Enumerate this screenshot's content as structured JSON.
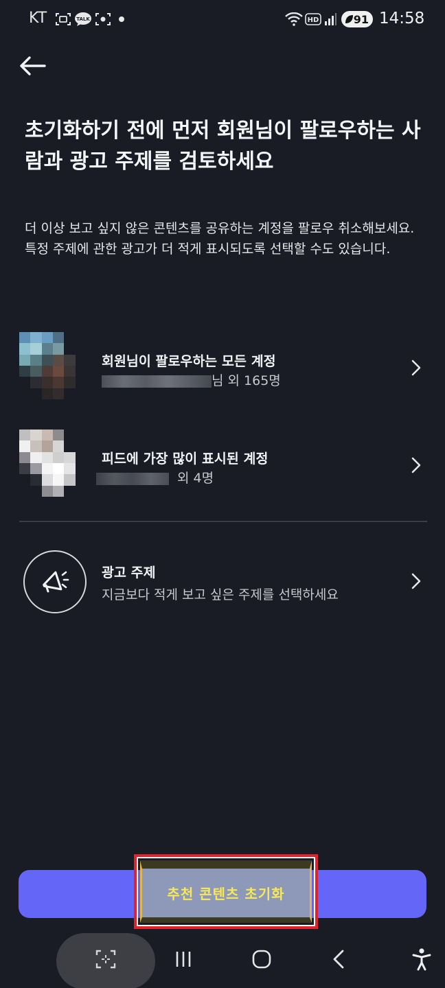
{
  "status_bar": {
    "carrier": "KT",
    "time": "14:58",
    "battery": "91",
    "icons": [
      "screenshot-icon",
      "kakaotalk-icon",
      "screen-capture-icon",
      "dot-icon",
      "wifi-icon",
      "hd-icon",
      "signal-icon",
      "battery-icon"
    ],
    "kakao_label": "TALK",
    "hd_label": "HD"
  },
  "header": {
    "back_icon": "arrow-left-icon",
    "title": "초기화하기 전에 먼저 회원님이 팔로우하는 사람과 광고 주제를 검토하세요",
    "description": "더 이상 보고 싶지 않은 콘텐츠를 공유하는 계정을 팔로우 취소해보세요. 특정 주제에 관한 광고가 더 적게 표시되도록 선택할 수도 있습니다."
  },
  "rows": [
    {
      "title": "회원님이 팔로우하는 모든 계정",
      "subtitle_suffix": "님 외 165명",
      "icon": "chevron-right-icon"
    },
    {
      "title": "피드에 가장 많이 표시된 계정",
      "subtitle_suffix": "외 4명",
      "icon": "chevron-right-icon"
    },
    {
      "title": "광고 주제",
      "subtitle": "지금보다 적게 보고 싶은 주제를 선택하세요",
      "icon": "megaphone-icon"
    }
  ],
  "reset_button": {
    "label": "추천 콘텐츠 초기화"
  },
  "nav_bar": {
    "icons": [
      "capture-icon",
      "recent-apps-icon",
      "home-icon",
      "back-icon",
      "accessibility-icon"
    ]
  },
  "colors": {
    "background": "#191c25",
    "accent": "#6366f7",
    "highlight_border": "#e1222c",
    "highlight_text": "#f7e85a"
  }
}
